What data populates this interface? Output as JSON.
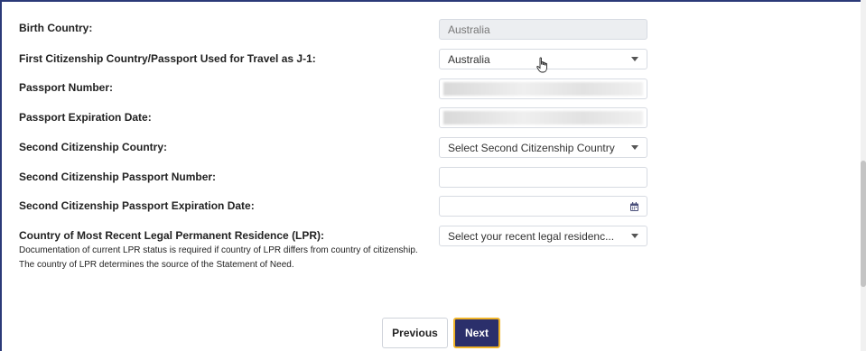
{
  "form": {
    "birth_country": {
      "label": "Birth Country:",
      "value": "Australia"
    },
    "first_citizenship": {
      "label": "First Citizenship Country/Passport Used for Travel as J-1:",
      "value": "Australia"
    },
    "passport_number": {
      "label": "Passport Number:",
      "value": ""
    },
    "passport_expiration": {
      "label": "Passport Expiration Date:",
      "value": ""
    },
    "second_citizenship": {
      "label": "Second Citizenship Country:",
      "value": "Select Second Citizenship Country"
    },
    "second_passport_number": {
      "label": "Second Citizenship Passport Number:",
      "value": ""
    },
    "second_passport_expiration": {
      "label": "Second Citizenship Passport Expiration Date:",
      "value": ""
    },
    "lpr_country": {
      "label": "Country of Most Recent Legal Permanent Residence (LPR):",
      "help": "Documentation of current LPR status is required if country of LPR differs from country of citizenship. The country of LPR determines the source of the Statement of Need.",
      "value": "Select your recent legal residenc..."
    }
  },
  "buttons": {
    "previous": "Previous",
    "next": "Next"
  },
  "colors": {
    "primary": "#2b2f6b",
    "focus": "#f0b429",
    "frame": "#2b3a78"
  },
  "icons": {
    "dropdown": "chevron-down-icon",
    "date": "calendar-icon",
    "cursor": "hand-cursor-icon"
  }
}
